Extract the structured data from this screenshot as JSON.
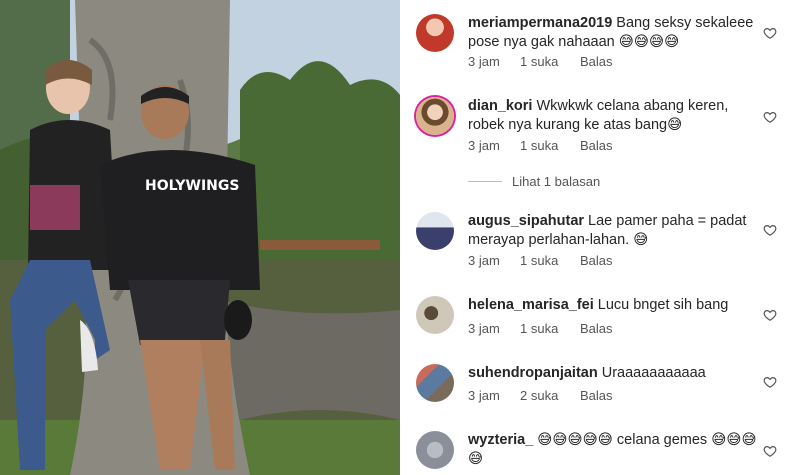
{
  "photo": {
    "shirt_text": "HOLYWINGS"
  },
  "comments": [
    {
      "username": "meriampermana2019",
      "text": "Bang seksy sekaleee pose nya gak nahaaan 😅😅😅😅",
      "time": "3 jam",
      "likes": "1 suka",
      "reply": "Balas",
      "avatar_color": "#c0392b",
      "story_ring": false
    },
    {
      "username": "dian_kori",
      "text": "Wkwkwk celana abang keren, robek nya kurang ke atas bang😅",
      "time": "3 jam",
      "likes": "1 suka",
      "reply": "Balas",
      "avatar_color": "#d9b38c",
      "story_ring": true
    },
    {
      "username": "augus_sipahutar",
      "text": "Lae pamer paha = padat merayap perlahan-lahan. 😅",
      "time": "3 jam",
      "likes": "1 suka",
      "reply": "Balas",
      "avatar_color": "#3b3f6b",
      "story_ring": false
    },
    {
      "username": "helena_marisa_fei",
      "text": "Lucu bnget sih bang",
      "time": "3 jam",
      "likes": "1 suka",
      "reply": "Balas",
      "avatar_color": "#cfc8b8",
      "story_ring": false
    },
    {
      "username": "suhendropanjaitan",
      "text": "Uraaaaaaaaaaa",
      "time": "3 jam",
      "likes": "2 suka",
      "reply": "Balas",
      "avatar_color": "#7a6a5a",
      "story_ring": false
    },
    {
      "username": "wyzteria_",
      "text": "😅😅😅😅😅 celana gemes 😅😅😅😅",
      "time": "",
      "likes": "",
      "reply": "",
      "avatar_color": "#8a8f99",
      "story_ring": false
    }
  ],
  "view_replies": "Lihat 1 balasan",
  "icons": {
    "like": "heart-outline-icon"
  }
}
